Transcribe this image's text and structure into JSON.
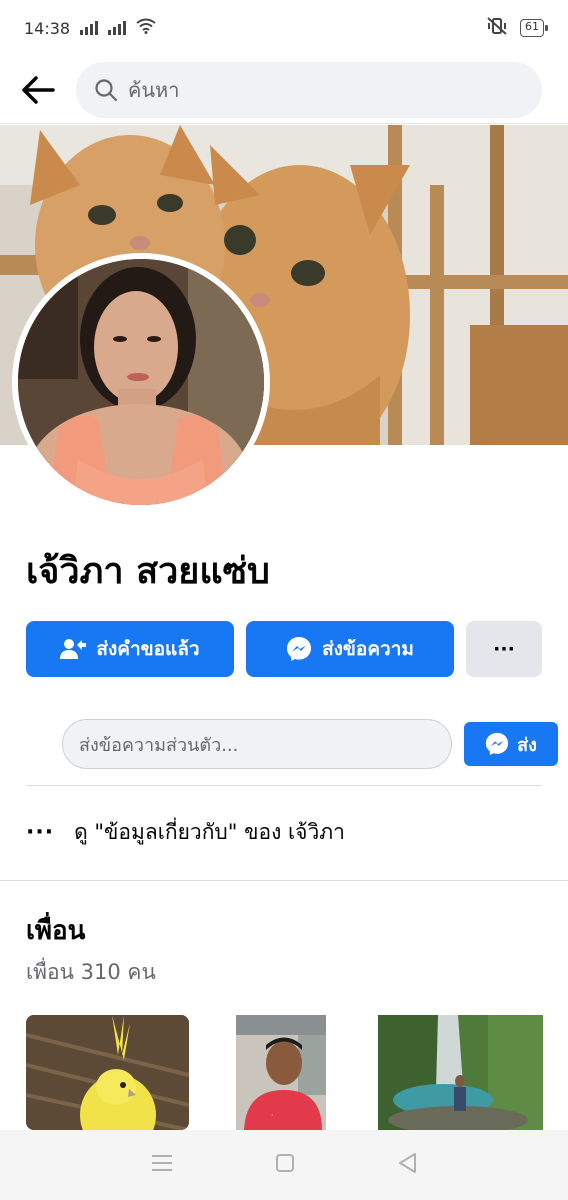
{
  "status_bar": {
    "time": "14:38",
    "battery": "61"
  },
  "topnav": {
    "search_placeholder": "ค้นหา"
  },
  "profile": {
    "name": "เจ้วิภา สวยแซ่บ"
  },
  "actions": {
    "friend_request_label": "ส่งคำขอแล้ว",
    "message_label": "ส่งข้อความ",
    "more_label": "···"
  },
  "message_row": {
    "placeholder": "ส่งข้อความส่วนตัว...",
    "send_label": "ส่ง"
  },
  "about": {
    "dots": "···",
    "text": "ดู \"ข้อมูลเกี่ยวกับ\" ของ เจ้วิภา"
  },
  "friends": {
    "title": "เพื่อน",
    "count_text": "เพื่อน 310 คน"
  },
  "colors": {
    "primary": "#1877f2",
    "secondary_button": "#e4e6eb",
    "input_bg": "#f0f2f5",
    "text_secondary": "#65676b"
  }
}
